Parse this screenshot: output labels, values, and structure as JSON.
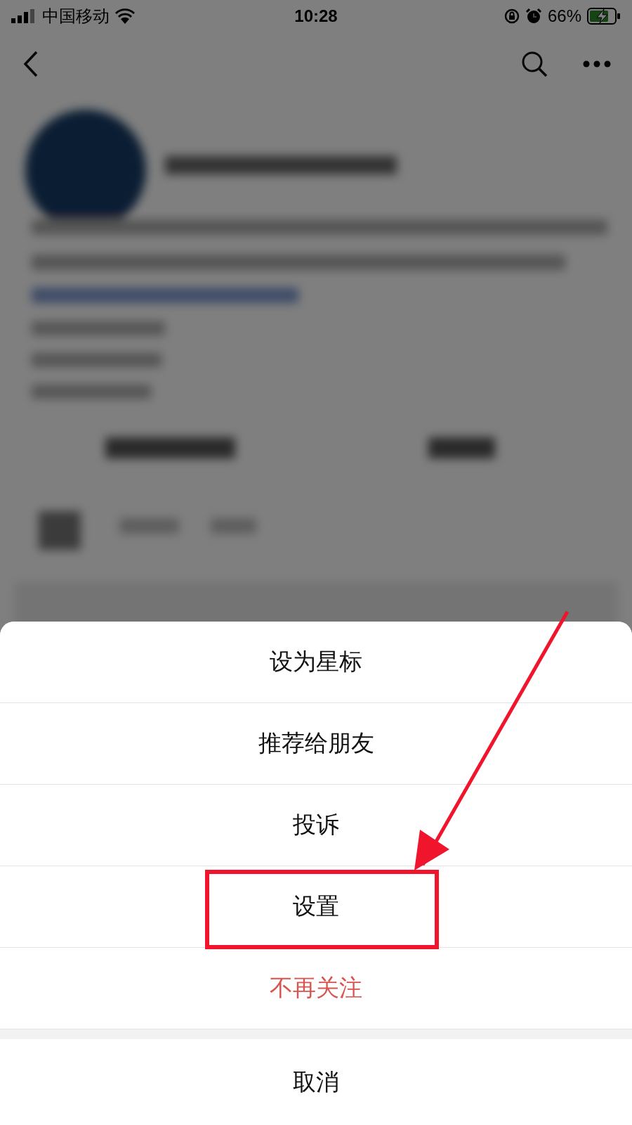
{
  "status_bar": {
    "carrier": "中国移动",
    "time": "10:28",
    "battery": "66%"
  },
  "action_sheet": {
    "items": [
      {
        "label": "设为星标",
        "kind": "normal",
        "highlighted": false
      },
      {
        "label": "推荐给朋友",
        "kind": "normal",
        "highlighted": false
      },
      {
        "label": "投诉",
        "kind": "normal",
        "highlighted": false
      },
      {
        "label": "设置",
        "kind": "normal",
        "highlighted": true
      },
      {
        "label": "不再关注",
        "kind": "destructive",
        "highlighted": false
      }
    ],
    "cancel": "取消"
  }
}
